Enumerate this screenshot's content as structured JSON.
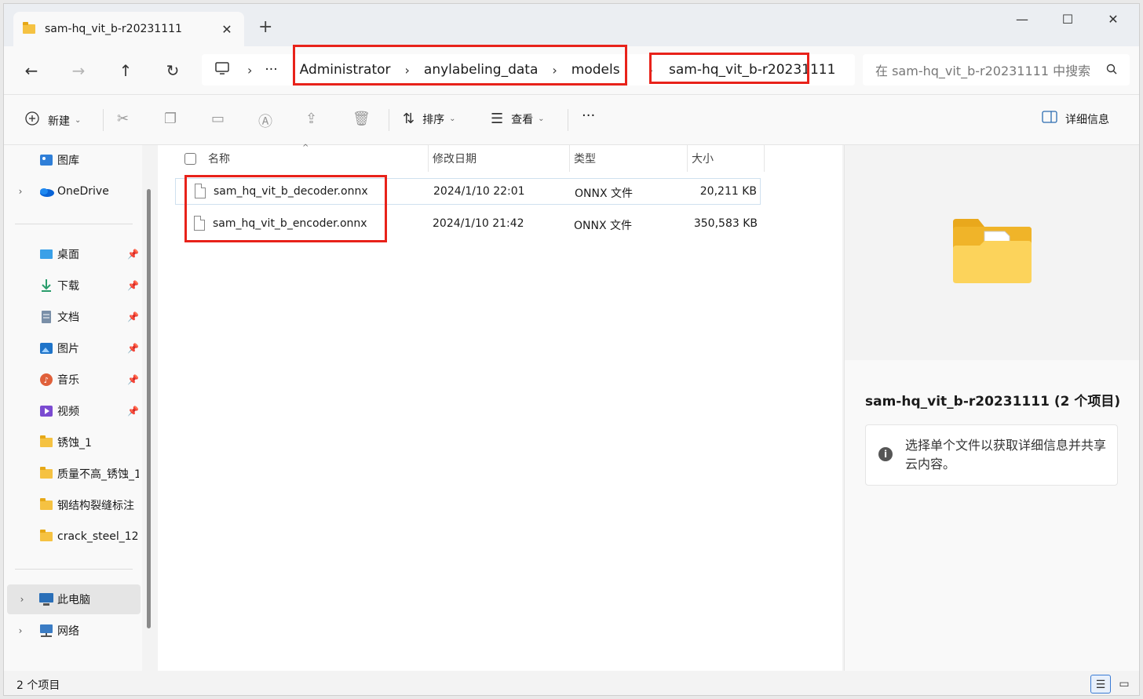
{
  "window": {
    "tab_title": "sam-hq_vit_b-r20231111",
    "tab_close": "✕",
    "new_tab": "+",
    "minimize": "—",
    "maximize": "☐",
    "close": "✕"
  },
  "nav": {
    "back": "←",
    "forward": "→",
    "up": "↑",
    "refresh": "↻"
  },
  "breadcrumb": {
    "more": "···",
    "items": [
      "Administrator",
      "anylabeling_data",
      "models",
      "sam-hq_vit_b-r20231111"
    ]
  },
  "search": {
    "placeholder": "在 sam-hq_vit_b-r20231111 中搜索",
    "icon": "search-icon"
  },
  "toolbar": {
    "new_label": "新建",
    "sort_label": "排序",
    "view_label": "查看",
    "more": "···",
    "details_label": "详细信息"
  },
  "sidebar": {
    "items": [
      {
        "label": "图库",
        "icon": "gallery-icon"
      },
      {
        "label": "OneDrive",
        "icon": "onedrive-icon"
      },
      {
        "label": "桌面",
        "icon": "desktop-icon"
      },
      {
        "label": "下载",
        "icon": "download-icon"
      },
      {
        "label": "文档",
        "icon": "document-icon"
      },
      {
        "label": "图片",
        "icon": "pictures-icon"
      },
      {
        "label": "音乐",
        "icon": "music-icon"
      },
      {
        "label": "视频",
        "icon": "video-icon"
      },
      {
        "label": "锈蚀_1",
        "icon": "folder-icon"
      },
      {
        "label": "质量不高_锈蚀_1",
        "icon": "folder-icon"
      },
      {
        "label": "钢结构裂缝标注",
        "icon": "folder-icon"
      },
      {
        "label": "crack_steel_12",
        "icon": "folder-icon"
      },
      {
        "label": "此电脑",
        "icon": "computer-icon"
      },
      {
        "label": "网络",
        "icon": "network-icon"
      }
    ]
  },
  "file_list": {
    "columns": [
      "名称",
      "修改日期",
      "类型",
      "大小"
    ],
    "rows": [
      {
        "name": "sam_hq_vit_b_decoder.onnx",
        "date": "2024/1/10 22:01",
        "type": "ONNX 文件",
        "size": "20,211 KB"
      },
      {
        "name": "sam_hq_vit_b_encoder.onnx",
        "date": "2024/1/10 21:42",
        "type": "ONNX 文件",
        "size": "350,583 KB"
      }
    ]
  },
  "details": {
    "title": "sam-hq_vit_b-r20231111 (2 个项目)",
    "message": "选择单个文件以获取详细信息并共享云内容。"
  },
  "status": {
    "item_count": "2 个项目"
  },
  "colors": {
    "highlight_box": "#e8221a",
    "folder": "#f5c242"
  }
}
